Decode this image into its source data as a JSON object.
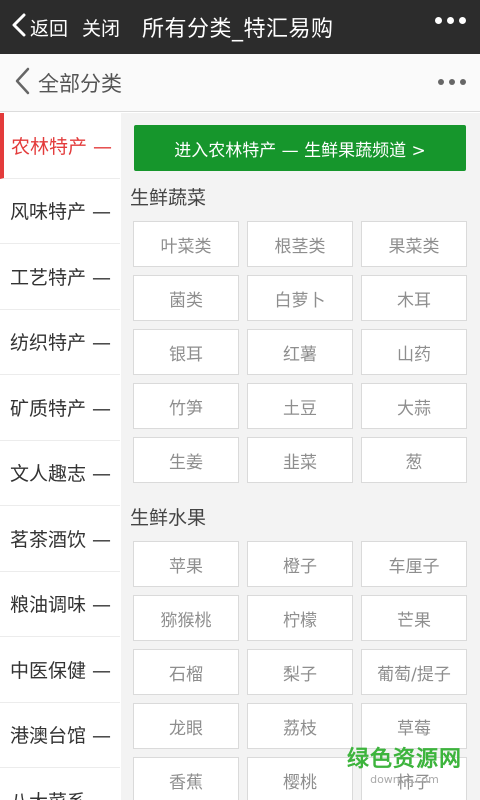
{
  "topbar": {
    "back_label": "返回",
    "close_label": "关闭",
    "title": "所有分类_特汇易购"
  },
  "header": {
    "title": "全部分类"
  },
  "sidebar": {
    "items": [
      {
        "label": "农林特产 —",
        "active": true
      },
      {
        "label": "风味特产 —"
      },
      {
        "label": "工艺特产 —"
      },
      {
        "label": "纺织特产 —"
      },
      {
        "label": "矿质特产 —"
      },
      {
        "label": "文人趣志 —"
      },
      {
        "label": "茗茶酒饮 —"
      },
      {
        "label": "粮油调味 —"
      },
      {
        "label": "中医保健 —"
      },
      {
        "label": "港澳台馆 —"
      },
      {
        "label": "八大菜系 —"
      }
    ]
  },
  "main": {
    "banner_label": "进入农林特产 — 生鲜果蔬频道 >",
    "sections": [
      {
        "title": "生鲜蔬菜",
        "items": [
          "叶菜类",
          "根茎类",
          "果菜类",
          "菌类",
          "白萝卜",
          "木耳",
          "银耳",
          "红薯",
          "山药",
          "竹笋",
          "土豆",
          "大蒜",
          "生姜",
          "韭菜",
          "葱"
        ]
      },
      {
        "title": "生鲜水果",
        "items": [
          "苹果",
          "橙子",
          "车厘子",
          "猕猴桃",
          "柠檬",
          "芒果",
          "石榴",
          "梨子",
          "葡萄/提子",
          "龙眼",
          "荔枝",
          "草莓",
          "香蕉",
          "樱桃",
          "柿子"
        ]
      }
    ]
  },
  "watermark": {
    "main": "绿色资源网",
    "sub": "downcc.com"
  },
  "colors": {
    "topbar_bg": "#2c2c2c",
    "active_red": "#e33b3b",
    "banner_green": "#16962c"
  }
}
